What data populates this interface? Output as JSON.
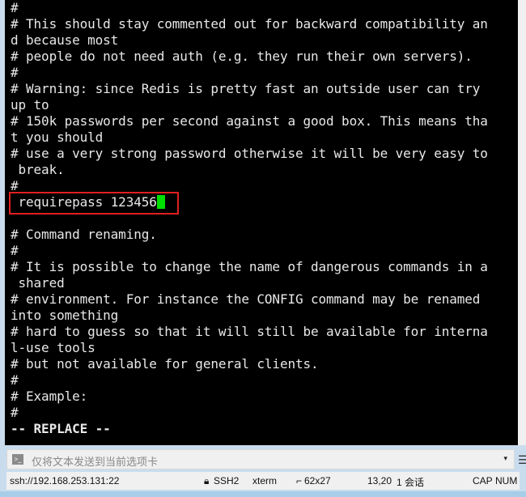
{
  "terminal": {
    "lines": [
      "#",
      "# This should stay commented out for backward compatibility an",
      "d because most",
      "# people do not need auth (e.g. they run their own servers).",
      "#",
      "# Warning: since Redis is pretty fast an outside user can try",
      "up to",
      "# 150k passwords per second against a good box. This means tha",
      "t you should",
      "# use a very strong password otherwise it will be very easy to",
      " break.",
      "#",
      " requirepass 123456",
      "",
      "# Command renaming.",
      "#",
      "# It is possible to change the name of dangerous commands in a",
      " shared",
      "# environment. For instance the CONFIG command may be renamed",
      "into something",
      "# hard to guess so that it will still be available for interna",
      "l-use tools",
      "# but not available for general clients.",
      "#",
      "# Example:",
      "#",
      "-- REPLACE --"
    ],
    "highlight_color": "#e02020",
    "cursor_color": "#00e000"
  },
  "input_bar": {
    "placeholder": "仅将文本发送到当前选项卡",
    "icon": "terminal-icon",
    "dropdown": "▾",
    "menu": "☰"
  },
  "status": {
    "connection": "ssh://192.168.253.131:22",
    "protocol": "SSH2",
    "term": "xterm",
    "size": "62x27",
    "cursor_pos": "13,20",
    "sessions": "1 会话",
    "caps": "CAP",
    "num": "NUM"
  }
}
